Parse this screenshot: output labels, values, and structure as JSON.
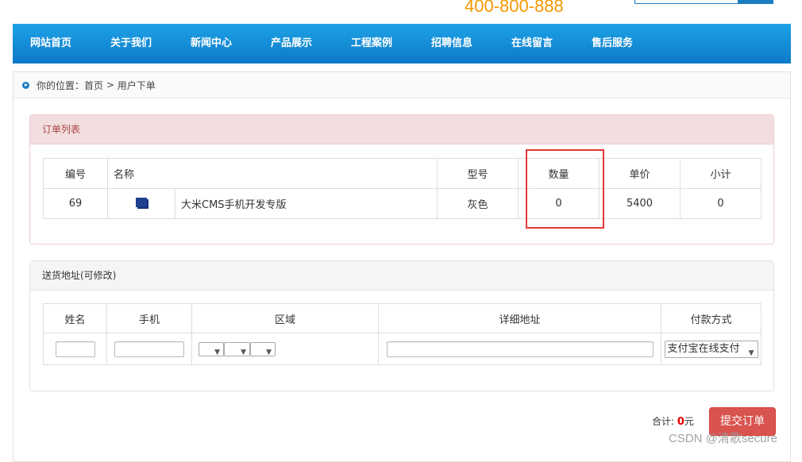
{
  "header": {
    "phone": "400-800-888"
  },
  "nav": {
    "items": [
      {
        "label": "网站首页"
      },
      {
        "label": "关于我们"
      },
      {
        "label": "新闻中心"
      },
      {
        "label": "产品展示"
      },
      {
        "label": "工程案例"
      },
      {
        "label": "招聘信息"
      },
      {
        "label": "在线留言"
      },
      {
        "label": "售后服务"
      }
    ]
  },
  "breadcrumb": {
    "prefix": "你的位置：",
    "home": "首页",
    "separator": " > ",
    "current": "用户下单"
  },
  "order_panel": {
    "title": "订单列表",
    "columns": [
      "编号",
      "名称",
      "型号",
      "数量",
      "单价",
      "小计"
    ],
    "rows": [
      {
        "id": "69",
        "name": "大米CMS手机开发专版",
        "model": "灰色",
        "quantity": "0",
        "price": "5400",
        "subtotal": "0"
      }
    ]
  },
  "address_panel": {
    "title": "送货地址(可修改)",
    "columns": [
      "姓名",
      "手机",
      "区域",
      "详细地址",
      "付款方式"
    ],
    "payment_selected": "支付宝在线支付"
  },
  "footer": {
    "total_label": "合计:",
    "total_value": "0",
    "total_unit": "元",
    "submit_label": "提交订单",
    "watermark": "CSDN @清歌secure"
  },
  "colors": {
    "nav_bg": "#0d79c8",
    "accent_orange": "#f39800",
    "submit_red": "#d9534f",
    "highlight_red": "#e53935"
  }
}
